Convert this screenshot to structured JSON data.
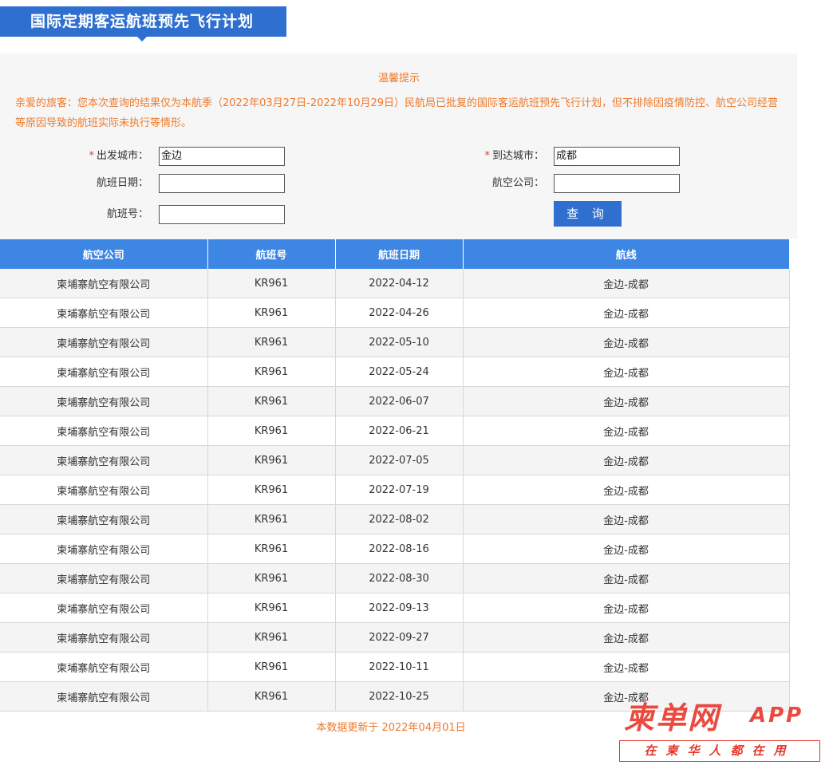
{
  "page_title": "国际定期客运航班预先飞行计划",
  "notice": {
    "title": "温馨提示",
    "body": "亲爱的旅客：您本次查询的结果仅为本航季（2022年03月27日-2022年10月29日）民航局已批复的国际客运航班预先飞行计划，但不排除因疫情防控、航空公司经营等原因导致的航班实际未执行等情形。"
  },
  "form": {
    "departure_label": "出发城市：",
    "departure_value": "金边",
    "arrival_label": "到达城市：",
    "arrival_value": "成都",
    "date_label": "航班日期：",
    "date_value": "",
    "airline_label": "航空公司：",
    "airline_value": "",
    "flight_no_label": "航班号：",
    "flight_no_value": "",
    "required_mark": "*",
    "query_button": "查 询"
  },
  "table": {
    "headers": [
      "航空公司",
      "航班号",
      "航班日期",
      "航线"
    ],
    "rows": [
      [
        "柬埔寨航空有限公司",
        "KR961",
        "2022-04-12",
        "金边-成都"
      ],
      [
        "柬埔寨航空有限公司",
        "KR961",
        "2022-04-26",
        "金边-成都"
      ],
      [
        "柬埔寨航空有限公司",
        "KR961",
        "2022-05-10",
        "金边-成都"
      ],
      [
        "柬埔寨航空有限公司",
        "KR961",
        "2022-05-24",
        "金边-成都"
      ],
      [
        "柬埔寨航空有限公司",
        "KR961",
        "2022-06-07",
        "金边-成都"
      ],
      [
        "柬埔寨航空有限公司",
        "KR961",
        "2022-06-21",
        "金边-成都"
      ],
      [
        "柬埔寨航空有限公司",
        "KR961",
        "2022-07-05",
        "金边-成都"
      ],
      [
        "柬埔寨航空有限公司",
        "KR961",
        "2022-07-19",
        "金边-成都"
      ],
      [
        "柬埔寨航空有限公司",
        "KR961",
        "2022-08-02",
        "金边-成都"
      ],
      [
        "柬埔寨航空有限公司",
        "KR961",
        "2022-08-16",
        "金边-成都"
      ],
      [
        "柬埔寨航空有限公司",
        "KR961",
        "2022-08-30",
        "金边-成都"
      ],
      [
        "柬埔寨航空有限公司",
        "KR961",
        "2022-09-13",
        "金边-成都"
      ],
      [
        "柬埔寨航空有限公司",
        "KR961",
        "2022-09-27",
        "金边-成都"
      ],
      [
        "柬埔寨航空有限公司",
        "KR961",
        "2022-10-11",
        "金边-成都"
      ],
      [
        "柬埔寨航空有限公司",
        "KR961",
        "2022-10-25",
        "金边-成都"
      ]
    ]
  },
  "footer_note": "本数据更新于 2022年04月01日",
  "watermark": {
    "logo": "柬单网",
    "app": "APP",
    "slogan": "在柬华人都在用"
  },
  "colors": {
    "brand_blue": "#2f6fcf",
    "header_blue": "#3d86e4",
    "notice_orange": "#ee7a2c",
    "watermark_red": "#e8372b"
  }
}
